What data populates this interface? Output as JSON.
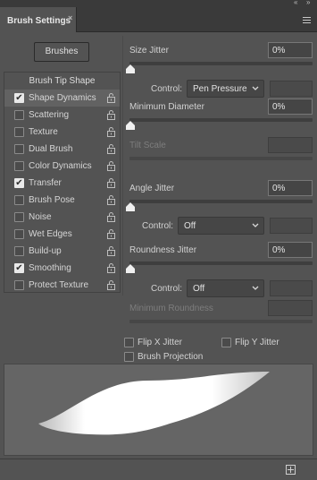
{
  "panel": {
    "title": "Brush Settings",
    "close_label": "×",
    "collapse_label": "«",
    "more_label": "»"
  },
  "brushes_button": "Brushes",
  "tip_shape_label": "Brush Tip Shape",
  "options": [
    {
      "label": "Shape Dynamics",
      "checked": true,
      "selected": true
    },
    {
      "label": "Scattering",
      "checked": false
    },
    {
      "label": "Texture",
      "checked": false
    },
    {
      "label": "Dual Brush",
      "checked": false
    },
    {
      "label": "Color Dynamics",
      "checked": false
    },
    {
      "label": "Transfer",
      "checked": true
    },
    {
      "label": "Brush Pose",
      "checked": false
    },
    {
      "label": "Noise",
      "checked": false
    },
    {
      "label": "Wet Edges",
      "checked": false
    },
    {
      "label": "Build-up",
      "checked": false
    },
    {
      "label": "Smoothing",
      "checked": true
    },
    {
      "label": "Protect Texture",
      "checked": false
    }
  ],
  "checkmark": "✔",
  "settings": {
    "size_jitter": {
      "label": "Size Jitter",
      "value": "0%"
    },
    "size_control": {
      "label": "Control:",
      "value": "Pen Pressure",
      "extra": ""
    },
    "min_diameter": {
      "label": "Minimum Diameter",
      "value": "0%"
    },
    "tilt_scale": {
      "label": "Tilt Scale",
      "value": ""
    },
    "angle_jitter": {
      "label": "Angle Jitter",
      "value": "0%"
    },
    "angle_control": {
      "label": "Control:",
      "value": "Off",
      "extra": ""
    },
    "roundness_jitter": {
      "label": "Roundness Jitter",
      "value": "0%"
    },
    "roundness_control": {
      "label": "Control:",
      "value": "Off",
      "extra": ""
    },
    "min_roundness": {
      "label": "Minimum Roundness",
      "value": ""
    }
  },
  "flags": {
    "flip_x": {
      "label": "Flip X Jitter",
      "checked": false
    },
    "flip_y": {
      "label": "Flip Y Jitter",
      "checked": false
    },
    "brush_projection": {
      "label": "Brush Projection",
      "checked": false
    }
  },
  "colors": {
    "panel_bg": "#535353",
    "dark_bg": "#3a3a3a",
    "preview_bg": "#656565",
    "stroke": "#ffffff"
  },
  "icons": [
    "collapse-icon",
    "close-icon",
    "panel-menu-icon",
    "lock-icon",
    "chevron-down-icon",
    "checkmark-icon",
    "new-preset-icon"
  ]
}
